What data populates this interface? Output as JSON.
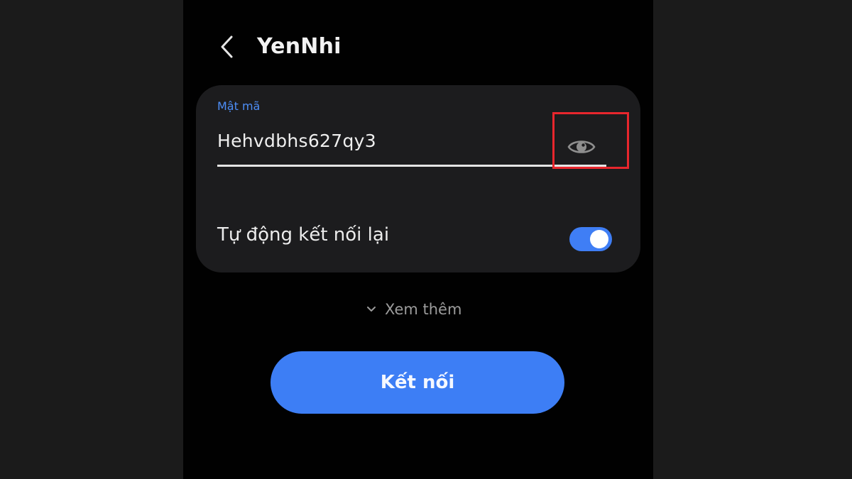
{
  "header": {
    "back_icon": "chevron-left-icon",
    "title": "YenNhi"
  },
  "password_field": {
    "label": "Mật mã",
    "value": "Hehvdbhs627qy3",
    "visibility_icon": "eye-icon",
    "highlight_color": "#e8262d"
  },
  "auto_reconnect": {
    "label": "Tự động kết nối lại",
    "enabled": true
  },
  "more": {
    "icon": "chevron-down-icon",
    "label": "Xem thêm"
  },
  "connect_button": {
    "label": "Kết nối"
  },
  "colors": {
    "accent": "#3d7ef5",
    "label_blue": "#4d8ef7",
    "card_bg": "#1c1c1e",
    "screen_bg": "#010101"
  }
}
